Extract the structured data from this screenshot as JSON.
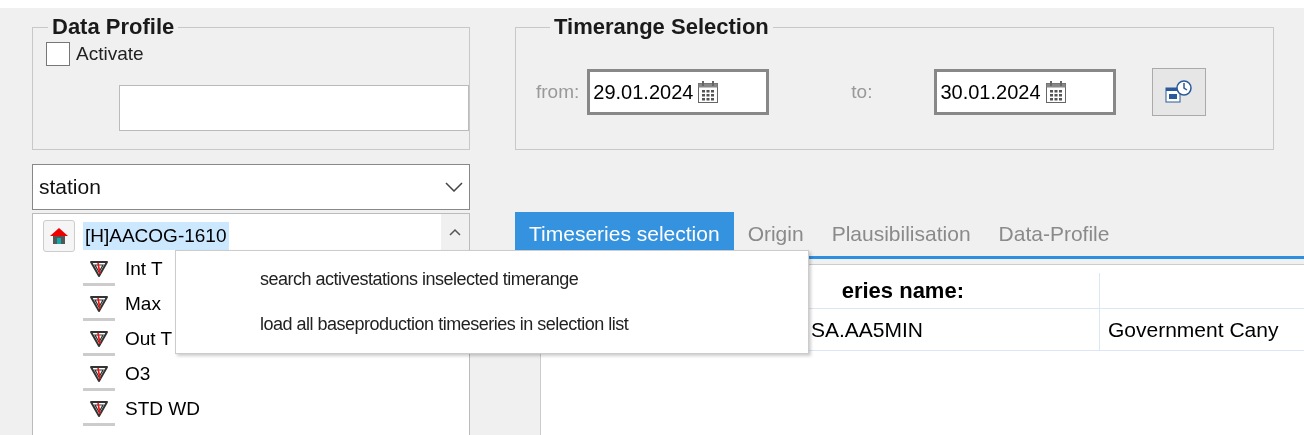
{
  "data_profile": {
    "title": "Data Profile",
    "activate": {
      "label": "Activate",
      "checked": false
    }
  },
  "station_select": {
    "value": "station"
  },
  "tree": [
    {
      "label": "[H]AACOG-1610",
      "selected": true,
      "children": [
        {
          "label": "Int T",
          "selected": false
        },
        {
          "label": "Max",
          "selected": false
        },
        {
          "label": "Out T",
          "selected": false
        },
        {
          "label": "O3",
          "selected": false
        },
        {
          "label": "STD WD",
          "selected": false
        }
      ]
    }
  ],
  "timerange": {
    "title": "Timerange Selection",
    "from_label": "from:",
    "from": "29.01.2024",
    "to_label": "to:",
    "to": "30.01.2024"
  },
  "tabs": [
    {
      "label": "Timeseries selection",
      "selected": true
    },
    {
      "label": "Origin",
      "selected": false
    },
    {
      "label": "Plausibilisation",
      "selected": false
    },
    {
      "label": "Data-Profile",
      "selected": false
    }
  ],
  "table": {
    "columns": [
      "eries name:"
    ],
    "rows": [
      {
        "cells": [
          "SA.AA5MIN",
          "Government Cany"
        ]
      }
    ]
  },
  "context_menu": {
    "items": [
      "search activestations inselected timerange",
      "load all baseproduction timeseries in selection list"
    ]
  }
}
